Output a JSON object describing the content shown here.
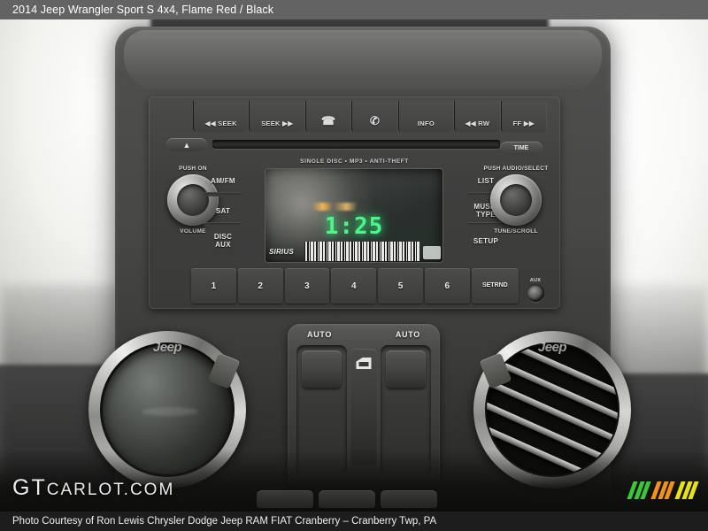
{
  "header": {
    "title": "2014 Jeep Wrangler Sport S 4x4,  Flame Red / Black"
  },
  "footer": {
    "caption": "Photo Courtesy of Ron Lewis Chrysler Dodge Jeep RAM FIAT Cranberry – Cranberry Twp, PA"
  },
  "watermark": {
    "prefix": "GT",
    "suffix": "CARLOT.COM",
    "bar_colors": [
      "#3cc63c",
      "#f0921e",
      "#e6e119"
    ]
  },
  "radio": {
    "top_buttons": [
      {
        "label": "◀◀ SEEK",
        "name": "seek-back-button"
      },
      {
        "label": "SEEK ▶▶",
        "name": "seek-forward-button"
      },
      {
        "label": "☎",
        "name": "voice-recognition-icon",
        "icon": true
      },
      {
        "label": "✆",
        "name": "phone-icon",
        "icon": true
      },
      {
        "label": "INFO",
        "name": "info-button"
      },
      {
        "label": "◀◀ RW",
        "name": "rewind-button"
      },
      {
        "label": "FF ▶▶",
        "name": "fast-forward-button"
      }
    ],
    "eject_label": "▲",
    "time_label": "TIME",
    "disc_legend": "SINGLE DISC • MP3 • ANTI-THEFT",
    "display": {
      "time": "1:25",
      "satellite_brand": "SIRIUS"
    },
    "left_knob": {
      "top_label": "PUSH ON",
      "bottom_label": "VOLUME"
    },
    "right_knob": {
      "top_label": "PUSH AUDIO/SELECT",
      "bottom_label": "TUNE/SCROLL"
    },
    "left_buttons": [
      {
        "label": "AM/FM",
        "name": "am-fm-button"
      },
      {
        "label": "SAT",
        "name": "sat-button"
      },
      {
        "label": "DISC\nAUX",
        "name": "disc-aux-button"
      }
    ],
    "right_buttons": [
      {
        "label": "LIST",
        "name": "list-button"
      },
      {
        "label": "MUSIC\nTYPE",
        "name": "music-type-button"
      },
      {
        "label": "SETUP",
        "name": "setup-button"
      }
    ],
    "presets": [
      "1",
      "2",
      "3",
      "4",
      "5",
      "6"
    ],
    "set_rnd_label": "SET\nRND",
    "aux_label": "AUX"
  },
  "switch_pod": {
    "auto_left": "AUTO",
    "auto_right": "AUTO"
  },
  "vents": {
    "left_brand": "Jeep",
    "right_brand": "Jeep"
  }
}
